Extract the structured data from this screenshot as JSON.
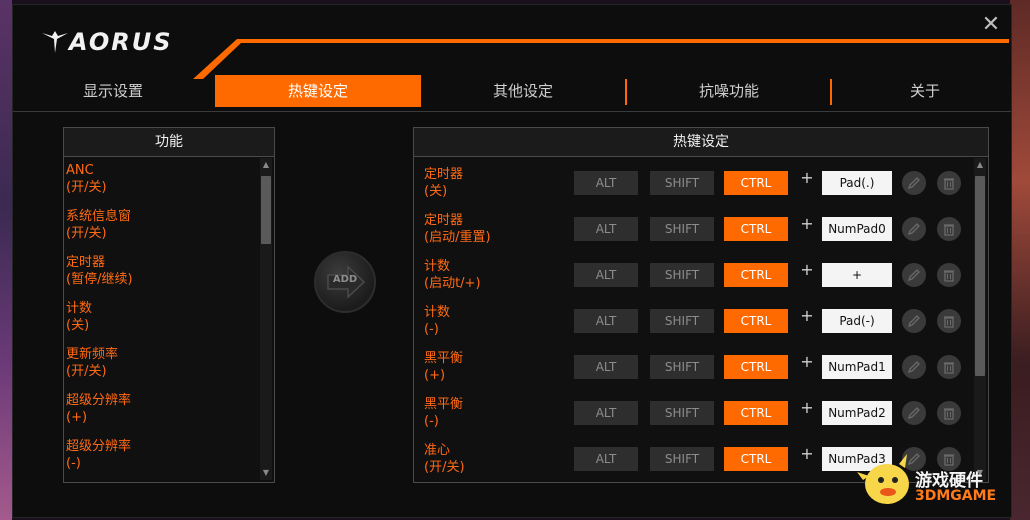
{
  "brand": {
    "logo_text": "AORUS"
  },
  "window": {
    "close_glyph": "✕"
  },
  "tabs": [
    {
      "label": "显示设置",
      "active": false
    },
    {
      "label": "热键设定",
      "active": true
    },
    {
      "label": "其他设定",
      "active": false
    },
    {
      "label": "抗噪功能",
      "active": false
    },
    {
      "label": "关于",
      "active": false
    }
  ],
  "functions": {
    "header": "功能",
    "items": [
      {
        "line1": "ANC",
        "line2": "(开/关)"
      },
      {
        "line1": "系统信息窗",
        "line2": "(开/关)"
      },
      {
        "line1": "定时器",
        "line2": "(暂停/继续)"
      },
      {
        "line1": "计数",
        "line2": "(关)"
      },
      {
        "line1": "更新频率",
        "line2": "(开/关)"
      },
      {
        "line1": "超级分辨率",
        "line2": "(+)"
      },
      {
        "line1": "超级分辨率",
        "line2": "(-)"
      }
    ]
  },
  "add_button": {
    "label": "ADD"
  },
  "hotkeys": {
    "header": "热键设定",
    "modifiers": {
      "alt": "ALT",
      "shift": "SHIFT",
      "ctrl": "CTRL"
    },
    "plus": "+",
    "rows": [
      {
        "line1": "定时器",
        "line2": "(关)",
        "alt": false,
        "shift": false,
        "ctrl": true,
        "key": "Pad(.)"
      },
      {
        "line1": "定时器",
        "line2": "(启动/重置)",
        "alt": false,
        "shift": false,
        "ctrl": true,
        "key": "NumPad0"
      },
      {
        "line1": "计数",
        "line2": "(启动t/+)",
        "alt": false,
        "shift": false,
        "ctrl": true,
        "key": "+"
      },
      {
        "line1": "计数",
        "line2": "(-)",
        "alt": false,
        "shift": false,
        "ctrl": true,
        "key": "Pad(-)"
      },
      {
        "line1": "黑平衡",
        "line2": "(+)",
        "alt": false,
        "shift": false,
        "ctrl": true,
        "key": "NumPad1"
      },
      {
        "line1": "黑平衡",
        "line2": "(-)",
        "alt": false,
        "shift": false,
        "ctrl": true,
        "key": "NumPad2"
      },
      {
        "line1": "准心",
        "line2": "(开/关)",
        "alt": false,
        "shift": false,
        "ctrl": true,
        "key": "NumPad3"
      }
    ]
  },
  "watermark": {
    "line1": "游戏硬件",
    "line2": "3DMGAME"
  },
  "colors": {
    "accent": "#ff6a00",
    "background": "#0d0d0d",
    "panel_border": "#4a4a4a"
  },
  "icons": {
    "edit": "pencil-icon",
    "delete": "trash-icon",
    "add": "arrow-right-icon",
    "close": "close-icon"
  }
}
